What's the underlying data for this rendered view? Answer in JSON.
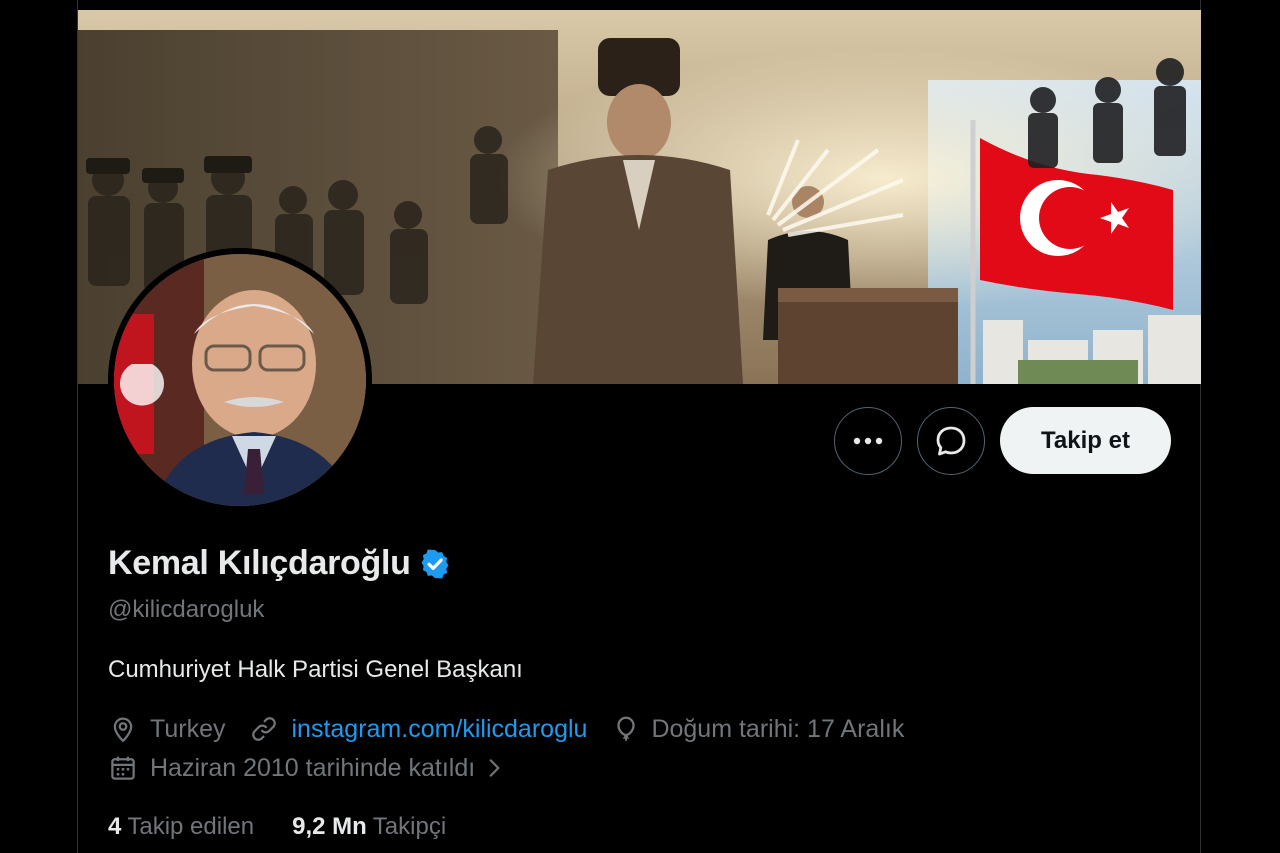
{
  "profile": {
    "name": "Kemal Kılıçdaroğlu",
    "handle": "@kilicdarogluk",
    "bio": "Cumhuriyet Halk Partisi Genel Başkanı",
    "location": "Turkey",
    "website": "instagram.com/kilicdaroglu",
    "birthday": "Doğum tarihi: 17 Aralık",
    "joined": "Haziran 2010 tarihinde katıldı",
    "verified": true
  },
  "actions": {
    "follow_label": "Takip et",
    "more_icon": "more-icon",
    "message_icon": "message-icon"
  },
  "stats": {
    "following_count": "4",
    "following_label": "Takip edilen",
    "followers_count": "9,2 Mn",
    "followers_label": "Takipçi"
  },
  "colors": {
    "background": "#000000",
    "text_primary": "#e7e9ea",
    "text_secondary": "#71767b",
    "link": "#1d9bf0",
    "verified_badge": "#1d9bf0",
    "follow_button_bg": "#eff3f4",
    "flag_red": "#e30a17"
  }
}
